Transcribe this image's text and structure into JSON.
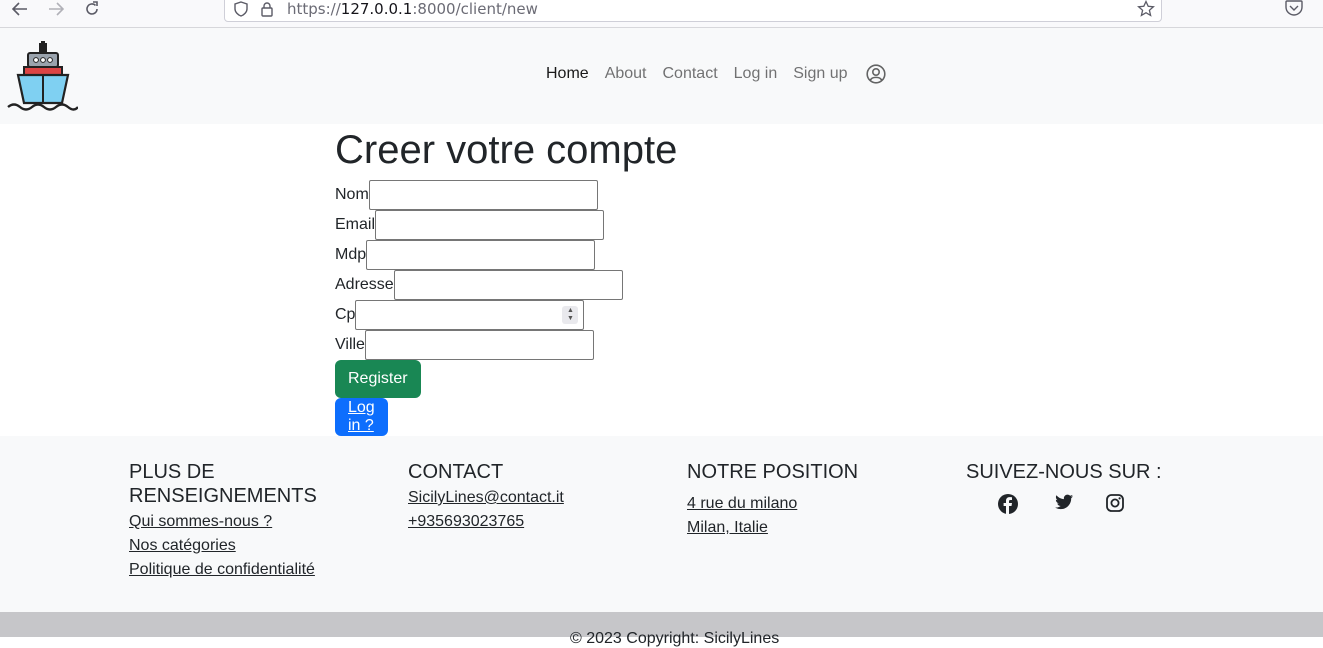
{
  "browser": {
    "url_prefix": "https://",
    "url_host": "127.0.0.1",
    "url_rest": ":8000/client/new",
    "icons": [
      "back-arrow-icon",
      "forward-arrow-icon",
      "reload-icon",
      "shield-icon",
      "lock-icon",
      "bookmark-star-icon",
      "pocket-icon"
    ]
  },
  "header": {
    "logo": "ship-logo",
    "nav": [
      {
        "label": "Home",
        "active": true
      },
      {
        "label": "About",
        "active": false
      },
      {
        "label": "Contact",
        "active": false
      },
      {
        "label": "Log in",
        "active": false
      },
      {
        "label": "Sign up",
        "active": false
      }
    ],
    "account_icon": "user-circle-icon"
  },
  "form": {
    "title": "Creer votre compte",
    "fields": [
      {
        "label": "Nom",
        "value": ""
      },
      {
        "label": "Email",
        "value": ""
      },
      {
        "label": "Mdp",
        "value": ""
      },
      {
        "label": "Adresse",
        "value": ""
      },
      {
        "label": "Cp",
        "value": "",
        "type": "number"
      },
      {
        "label": "Ville",
        "value": ""
      }
    ],
    "register_label": "Register",
    "login_label": "Log in ?",
    "colors": {
      "register": "#198754",
      "login": "#0d6efd"
    }
  },
  "footer": {
    "col1": {
      "heading": "PLUS DE RENSEIGNEMENTS",
      "links": [
        "Qui sommes-nous ?",
        "Nos catégories",
        "Politique de confidentialité"
      ]
    },
    "col2": {
      "heading": "CONTACT",
      "links": [
        "SicilyLines@contact.it",
        "+935693023765"
      ]
    },
    "col3": {
      "heading": "NOTRE POSITION",
      "links": [
        "4 rue du milano",
        "Milan, Italie"
      ]
    },
    "col4": {
      "heading": "SUIVEZ-NOUS SUR :",
      "social_icons": [
        "facebook-icon",
        "twitter-icon",
        "instagram-icon"
      ]
    },
    "copyright": "© 2023 Copyright: SicilyLines"
  }
}
